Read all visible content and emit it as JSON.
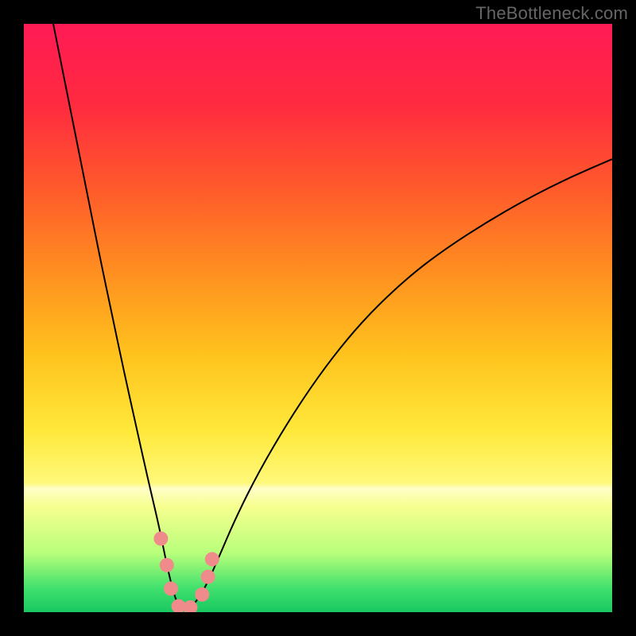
{
  "watermark": "TheBottleneck.com",
  "chart_data": {
    "type": "line",
    "title": "",
    "xlabel": "",
    "ylabel": "",
    "xlim": [
      0,
      100
    ],
    "ylim": [
      0,
      100
    ],
    "grid": false,
    "legend": false,
    "annotations": [],
    "background": {
      "type": "vertical-gradient",
      "stops": [
        {
          "pos": 0,
          "color": "#ff1a55"
        },
        {
          "pos": 14,
          "color": "#ff2b3f"
        },
        {
          "pos": 28,
          "color": "#ff5a2b"
        },
        {
          "pos": 42,
          "color": "#ff8e20"
        },
        {
          "pos": 56,
          "color": "#ffc21d"
        },
        {
          "pos": 69,
          "color": "#ffe83a"
        },
        {
          "pos": 78,
          "color": "#fff97a"
        },
        {
          "pos": 79,
          "color": "#fffec8"
        },
        {
          "pos": 82,
          "color": "#f7ff8f"
        },
        {
          "pos": 90,
          "color": "#b7ff7a"
        },
        {
          "pos": 96,
          "color": "#3fe06d"
        },
        {
          "pos": 100,
          "color": "#19c861"
        }
      ]
    },
    "series": [
      {
        "name": "bottleneck-curve",
        "color": "#000000",
        "width": 2,
        "x": [
          5,
          7,
          9,
          11,
          13,
          15,
          17,
          19,
          21,
          23,
          24,
          25,
          25.8,
          26.5,
          27.5,
          29,
          31,
          33,
          36,
          40,
          45,
          50,
          55,
          60,
          66,
          72,
          79,
          86,
          93,
          100
        ],
        "y": [
          100,
          90,
          80,
          70,
          60,
          50.5,
          41,
          32,
          23,
          14.5,
          9.5,
          5,
          2.2,
          0.8,
          0.6,
          1.3,
          4.5,
          9,
          16,
          24,
          32.5,
          40,
          46.5,
          52,
          57.5,
          62,
          66.5,
          70.5,
          74,
          77
        ]
      }
    ],
    "markers": [
      {
        "name": "marker-left-1",
        "x": 23.3,
        "y": 12.5,
        "color": "#f08b8b",
        "r": 9
      },
      {
        "name": "marker-left-2",
        "x": 24.3,
        "y": 8,
        "color": "#f08b8b",
        "r": 9
      },
      {
        "name": "marker-left-3",
        "x": 25.0,
        "y": 4,
        "color": "#f08b8b",
        "r": 9
      },
      {
        "name": "marker-bot-1",
        "x": 26.3,
        "y": 1,
        "color": "#f08b8b",
        "r": 9
      },
      {
        "name": "marker-bot-2",
        "x": 28.3,
        "y": 0.8,
        "color": "#f08b8b",
        "r": 9
      },
      {
        "name": "marker-right-1",
        "x": 30.3,
        "y": 3,
        "color": "#f08b8b",
        "r": 9
      },
      {
        "name": "marker-right-2",
        "x": 31.3,
        "y": 6,
        "color": "#f08b8b",
        "r": 9
      },
      {
        "name": "marker-right-3",
        "x": 32.0,
        "y": 9,
        "color": "#f08b8b",
        "r": 9
      }
    ]
  }
}
